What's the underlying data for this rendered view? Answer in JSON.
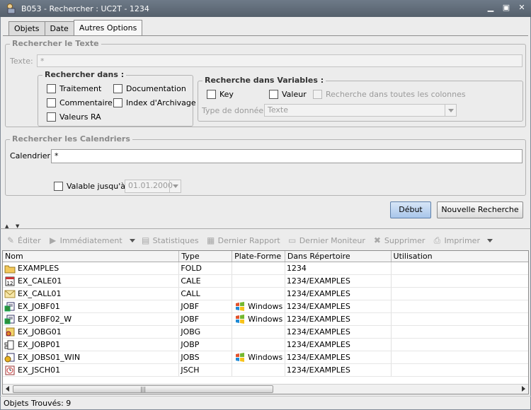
{
  "window": {
    "title": "B053 - Rechercher : UC2T - 1234"
  },
  "tabs": [
    {
      "label": "Objets"
    },
    {
      "label": "Date"
    },
    {
      "label": "Autres Options"
    }
  ],
  "search_text": {
    "legend": "Rechercher le Texte",
    "texte_label": "Texte:",
    "texte_value": "*",
    "search_in": {
      "legend": "Rechercher dans :",
      "traitement": "Traitement",
      "documentation": "Documentation",
      "commentaire": "Commentaire",
      "index_archivage": "Index d'Archivage",
      "valeurs_ra": "Valeurs RA"
    },
    "variables": {
      "legend": "Recherche dans Variables :",
      "key": "Key",
      "valeur": "Valeur",
      "all_columns": "Recherche dans toutes les colonnes",
      "data_type_label": "Type de donnée:",
      "data_type_value": "Texte"
    }
  },
  "calendars": {
    "legend": "Rechercher les Calendriers",
    "calendrier_label": "Calendrier:",
    "calendrier_value": "*",
    "valid_until_label": "Valable jusqu'à :",
    "valid_until_value": "01.01.2000"
  },
  "buttons": {
    "debut": "Début",
    "nouvelle": "Nouvelle Recherche"
  },
  "toolbar": {
    "editer": "Éditer",
    "immediatement": "Immédiatement",
    "statistiques": "Statistiques",
    "dernier_rapport": "Dernier Rapport",
    "dernier_moniteur": "Dernier Moniteur",
    "supprimer": "Supprimer",
    "imprimer": "Imprimer"
  },
  "table": {
    "columns": [
      "Nom",
      "Type",
      "Plate-Forme",
      "Dans Répertoire",
      "Utilisation"
    ],
    "rows": [
      {
        "icon": "folder-icon",
        "name": "EXAMPLES",
        "type": "FOLD",
        "platform": "",
        "dir": "1234",
        "usage": ""
      },
      {
        "icon": "calendar-icon",
        "name": "EX_CALE01",
        "type": "CALE",
        "platform": "",
        "dir": "1234/EXAMPLES",
        "usage": ""
      },
      {
        "icon": "envelope-icon",
        "name": "EX_CALL01",
        "type": "CALL",
        "platform": "",
        "dir": "1234/EXAMPLES",
        "usage": ""
      },
      {
        "icon": "job-icon",
        "name": "EX_JOBF01",
        "type": "JOBF",
        "platform": "Windows",
        "dir": "1234/EXAMPLES",
        "usage": ""
      },
      {
        "icon": "job-icon",
        "name": "EX_JOBF02_W",
        "type": "JOBF",
        "platform": "Windows",
        "dir": "1234/EXAMPLES",
        "usage": ""
      },
      {
        "icon": "jobgroup-icon",
        "name": "EX_JOBG01",
        "type": "JOBG",
        "platform": "",
        "dir": "1234/EXAMPLES",
        "usage": ""
      },
      {
        "icon": "jobplan-icon",
        "name": "EX_JOBP01",
        "type": "JOBP",
        "platform": "",
        "dir": "1234/EXAMPLES",
        "usage": ""
      },
      {
        "icon": "jobs-icon",
        "name": "EX_JOBS01_WIN",
        "type": "JOBS",
        "platform": "Windows",
        "dir": "1234/EXAMPLES",
        "usage": ""
      },
      {
        "icon": "schedule-icon",
        "name": "EX_JSCH01",
        "type": "JSCH",
        "platform": "",
        "dir": "1234/EXAMPLES",
        "usage": ""
      }
    ]
  },
  "status": {
    "text": "Objets Trouvés: 9"
  }
}
